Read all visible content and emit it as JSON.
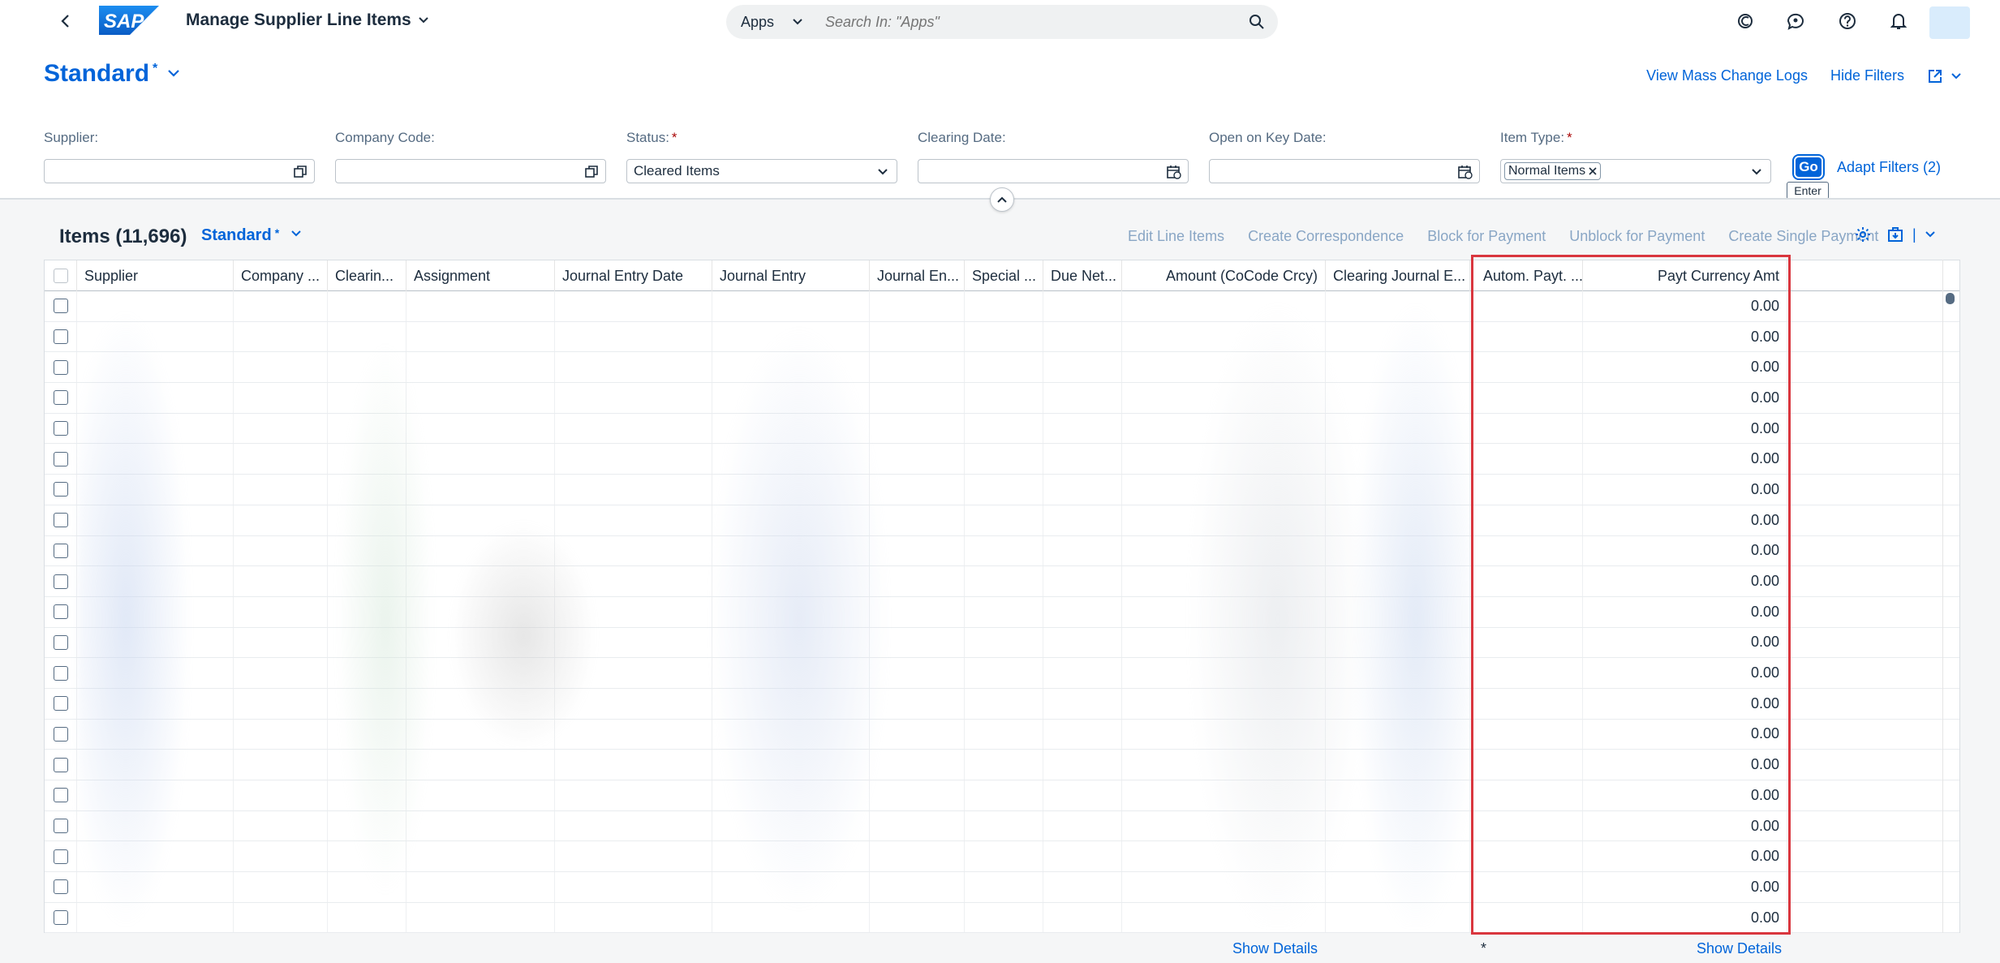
{
  "shell": {
    "app_title": "Manage Supplier Line Items",
    "search_scope": "Apps",
    "search_placeholder": "Search In: \"Apps\"",
    "logo_text": "SAP"
  },
  "header": {
    "variant": "Standard",
    "variant_modified": "*",
    "actions": [
      "View Mass Change Logs",
      "Hide Filters"
    ]
  },
  "filters": {
    "supplier": {
      "label": "Supplier:",
      "value": ""
    },
    "company_code": {
      "label": "Company Code:",
      "value": ""
    },
    "status": {
      "label": "Status:",
      "required": "*",
      "value": "Cleared Items"
    },
    "clearing_date": {
      "label": "Clearing Date:",
      "value": ""
    },
    "open_key_date": {
      "label": "Open on Key Date:",
      "value": ""
    },
    "item_type": {
      "label": "Item Type:",
      "required": "*",
      "token": "Normal Items"
    },
    "go_label": "Go",
    "go_tooltip": "Enter",
    "adapt_label": "Adapt Filters (2)"
  },
  "table": {
    "title": "Items (11,696)",
    "variant": "Standard",
    "variant_modified": "*",
    "actions": [
      "Edit Line Items",
      "Create Correspondence",
      "Block for Payment",
      "Unblock for Payment",
      "Create Single Payment"
    ],
    "columns": [
      "Supplier",
      "Company ...",
      "Clearin...",
      "Assignment",
      "Journal Entry Date",
      "Journal Entry",
      "Journal En...",
      "Special ...",
      "Due Net...",
      "Amount (CoCode Crcy)",
      "Clearing Journal E...",
      "Autom. Payt. ...",
      "Payt Currency Amt"
    ],
    "rows": [
      "0.00",
      "0.00",
      "0.00",
      "0.00",
      "0.00",
      "0.00",
      "0.00",
      "0.00",
      "0.00",
      "0.00",
      "0.00",
      "0.00",
      "0.00",
      "0.00",
      "0.00",
      "0.00",
      "0.00",
      "0.00",
      "0.00",
      "0.00",
      "0.00"
    ],
    "footer": {
      "show_details_1": "Show Details",
      "asterisk": "*",
      "show_details_2": "Show Details"
    }
  },
  "colors": {
    "brand": "#0064d9",
    "highlight": "#d9363e"
  }
}
